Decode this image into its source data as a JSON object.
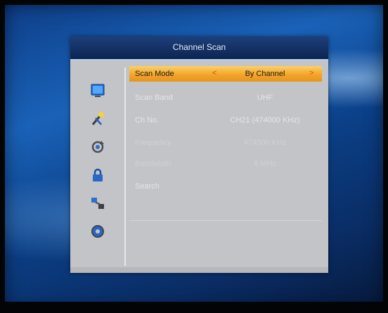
{
  "dialog": {
    "title": "Channel Scan"
  },
  "side_icons": [
    {
      "name": "tv-icon"
    },
    {
      "name": "tools-icon"
    },
    {
      "name": "refresh-icon"
    },
    {
      "name": "lock-icon"
    },
    {
      "name": "network-icon"
    },
    {
      "name": "settings-icon"
    }
  ],
  "rows": [
    {
      "label": "Scan Mode",
      "value": "By Channel",
      "selected": true
    },
    {
      "label": "Scan Band",
      "value": "UHF"
    },
    {
      "label": "Ch No.",
      "value": "CH21 (474000 KHz)"
    },
    {
      "label": "Frequency",
      "value": "474000 KHz"
    },
    {
      "label": "Bandwidth",
      "value": "8 MHz"
    },
    {
      "label": "Search",
      "value": ""
    }
  ],
  "colors": {
    "selected_bg": "#f3a52b",
    "title_bg": "#0c2552",
    "panel_bg": "#c2c4c7"
  }
}
